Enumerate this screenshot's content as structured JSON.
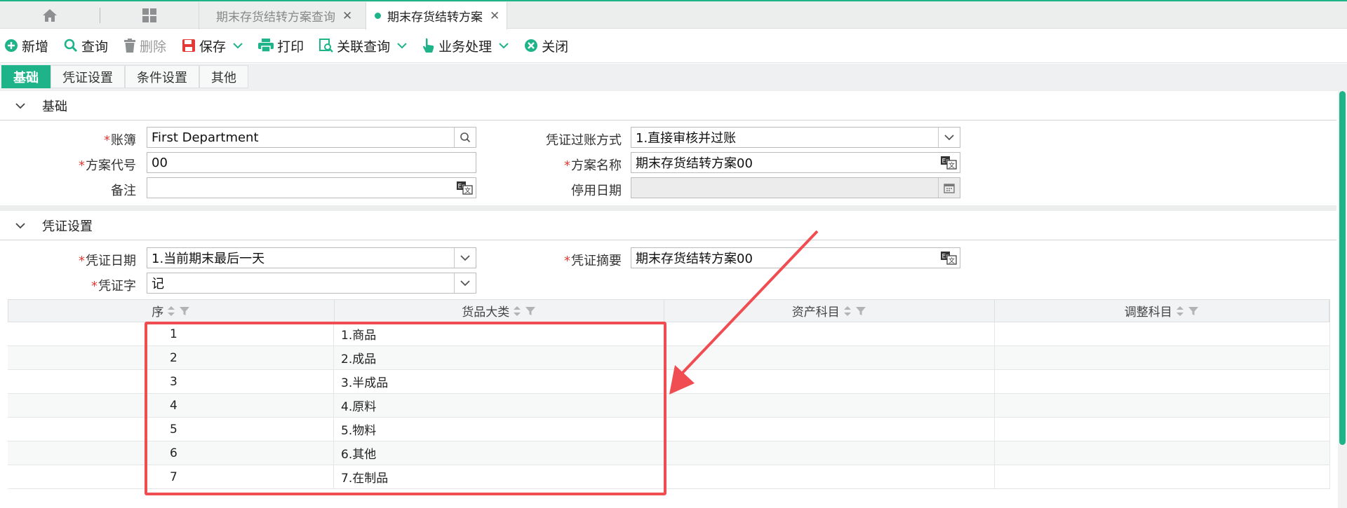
{
  "tabbar": {
    "tabs": [
      {
        "label": "期末存货结转方案查询",
        "active": false
      },
      {
        "label": "期末存货结转方案",
        "active": true
      }
    ]
  },
  "toolbar": {
    "new": "新增",
    "query": "查询",
    "delete": "删除",
    "save": "保存",
    "print": "打印",
    "related_query": "关联查询",
    "business": "业务处理",
    "close": "关闭"
  },
  "subtabs": [
    "基础",
    "凭证设置",
    "条件设置",
    "其他"
  ],
  "basic": {
    "title": "基础",
    "ledger_label": "账簿",
    "ledger_value": "First Department",
    "posting_label": "凭证过账方式",
    "posting_value": "1.直接审核并过账",
    "code_label": "方案代号",
    "code_value": "00",
    "name_label": "方案名称",
    "name_value": "期末存货结转方案00",
    "remark_label": "备注",
    "remark_value": "",
    "disable_date_label": "停用日期",
    "disable_date_value": ""
  },
  "voucher": {
    "title": "凭证设置",
    "date_label": "凭证日期",
    "date_value": "1.当前期末最后一天",
    "summary_label": "凭证摘要",
    "summary_value": "期末存货结转方案00",
    "word_label": "凭证字",
    "word_value": "记"
  },
  "grid": {
    "columns": [
      "序",
      "货品大类",
      "资产科目",
      "调整科目"
    ],
    "rows": [
      {
        "seq": "1",
        "category": "1.商品",
        "asset": "",
        "adjust": ""
      },
      {
        "seq": "2",
        "category": "2.成品",
        "asset": "",
        "adjust": ""
      },
      {
        "seq": "3",
        "category": "3.半成品",
        "asset": "",
        "adjust": ""
      },
      {
        "seq": "4",
        "category": "4.原料",
        "asset": "",
        "adjust": ""
      },
      {
        "seq": "5",
        "category": "5.物料",
        "asset": "",
        "adjust": ""
      },
      {
        "seq": "6",
        "category": "6.其他",
        "asset": "",
        "adjust": ""
      },
      {
        "seq": "7",
        "category": "7.在制品",
        "asset": "",
        "adjust": ""
      }
    ]
  },
  "colors": {
    "accent": "#1fb38a",
    "highlight": "#f04d52",
    "required": "#e53935"
  }
}
